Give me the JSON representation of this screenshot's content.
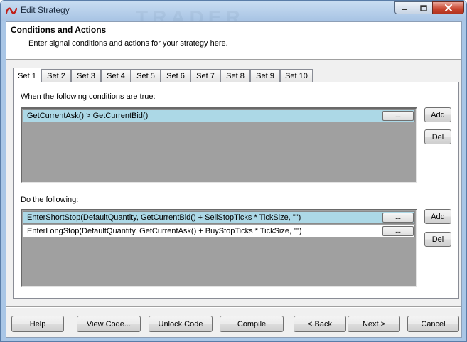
{
  "window": {
    "title": "Edit Strategy",
    "watermark": "TRADER"
  },
  "header": {
    "title": "Conditions and Actions",
    "subtitle": "Enter signal conditions and actions for your strategy here."
  },
  "tabs": [
    {
      "label": "Set 1",
      "active": true
    },
    {
      "label": "Set 2"
    },
    {
      "label": "Set 3"
    },
    {
      "label": "Set 4"
    },
    {
      "label": "Set 5"
    },
    {
      "label": "Set 6"
    },
    {
      "label": "Set 7"
    },
    {
      "label": "Set 8"
    },
    {
      "label": "Set 9"
    },
    {
      "label": "Set 10"
    }
  ],
  "conditions": {
    "label": "When the following conditions are true:",
    "items": [
      {
        "text": "GetCurrentAsk() > GetCurrentBid()",
        "button": "...",
        "selected": true
      }
    ],
    "add_label": "Add",
    "del_label": "Del"
  },
  "actions": {
    "label": "Do the following:",
    "items": [
      {
        "text": "EnterShortStop(DefaultQuantity, GetCurrentBid() + SellStopTicks * TickSize, \"\")",
        "button": "...",
        "selected": true
      },
      {
        "text": "EnterLongStop(DefaultQuantity, GetCurrentAsk() + BuyStopTicks * TickSize, \"\")",
        "button": "...",
        "selected": false
      }
    ],
    "add_label": "Add",
    "del_label": "Del"
  },
  "footer": {
    "help": "Help",
    "view_code": "View Code...",
    "unlock_code": "Unlock Code",
    "compile": "Compile",
    "back": "< Back",
    "next": "Next >",
    "cancel": "Cancel"
  },
  "colors": {
    "selection": "#acd8e6",
    "list_bg": "#a0a0a0",
    "titlebar": "#a9c6e6",
    "close_button": "#c8452f"
  }
}
